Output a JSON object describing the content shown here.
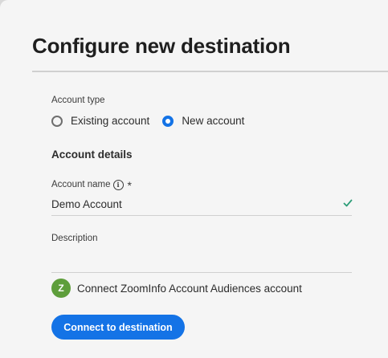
{
  "page": {
    "title": "Configure new destination"
  },
  "account_type": {
    "label": "Account type",
    "options": [
      {
        "label": "Existing account",
        "selected": false
      },
      {
        "label": "New account",
        "selected": true
      }
    ]
  },
  "account_details": {
    "heading": "Account details",
    "name_label": "Account name",
    "required_marker": "*",
    "name_value": "Demo Account",
    "description_label": "Description",
    "description_value": ""
  },
  "connection": {
    "logo_letter": "Z",
    "text": "Connect ZoomInfo Account Audiences account",
    "button_label": "Connect to destination"
  },
  "colors": {
    "accent": "#1473e6",
    "valid": "#2d9d78",
    "logo": "#5e9e3b"
  }
}
